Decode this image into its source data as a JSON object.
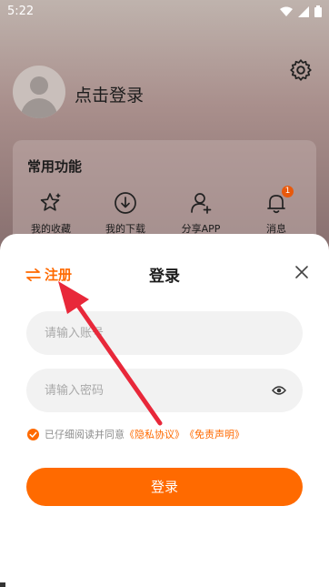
{
  "status_bar": {
    "time": "5:22"
  },
  "profile": {
    "login_prompt": "点击登录"
  },
  "functions": {
    "title": "常用功能",
    "items": [
      {
        "label": "我的收藏",
        "icon": "star-icon"
      },
      {
        "label": "我的下载",
        "icon": "download-icon"
      },
      {
        "label": "分享APP",
        "icon": "add-user-icon"
      },
      {
        "label": "消息",
        "icon": "bell-icon",
        "badge": "1"
      }
    ]
  },
  "login_sheet": {
    "register_label": "注册",
    "title": "登录",
    "account_placeholder": "请输入账号",
    "password_placeholder": "请输入密码",
    "agreement_prefix": "已仔细阅读并同意",
    "privacy_link": "《隐私协议》",
    "disclaimer_link": "《免责声明》",
    "login_button": "登录"
  },
  "colors": {
    "accent": "#ff6a00",
    "arrow": "#e8283a"
  }
}
